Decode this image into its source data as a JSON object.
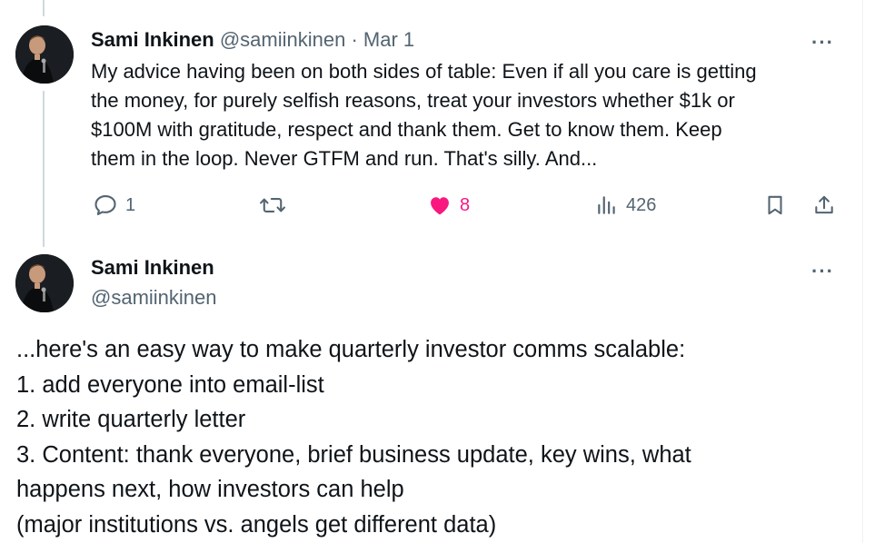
{
  "tweet1": {
    "author_name": "Sami Inkinen",
    "handle": "@samiinkinen",
    "separator": "·",
    "date": "Mar 1",
    "text_lines": [
      "My advice having been on both sides of table: Even if all you care is getting",
      "the money, for purely selfish reasons, treat your investors whether $1k or",
      "$100M with gratitude, respect and thank them. Get to know them. Keep",
      "them in the loop. Never GTFM and run. That's silly. And..."
    ],
    "actions": {
      "reply_count": "1",
      "retweet_count": "",
      "like_count": "8",
      "views_count": "426"
    },
    "more_label": "···"
  },
  "tweet2": {
    "author_name": "Sami Inkinen",
    "handle": "@samiinkinen",
    "more_label": "···",
    "text_lines": [
      "...here's an easy way to make quarterly investor comms scalable:",
      " 1. add everyone into email-list",
      " 2. write quarterly letter",
      " 3. Content: thank everyone, brief business update, key wins, what",
      "happens next, how investors can help",
      "(major institutions vs. angels get different data)"
    ]
  },
  "colors": {
    "text": "#0f1419",
    "secondary": "#536471",
    "like": "#f91880",
    "thread_line": "#cfd9de"
  },
  "icons": [
    "reply-icon",
    "retweet-icon",
    "heart-icon",
    "views-icon",
    "bookmark-icon",
    "share-icon",
    "more-icon"
  ]
}
